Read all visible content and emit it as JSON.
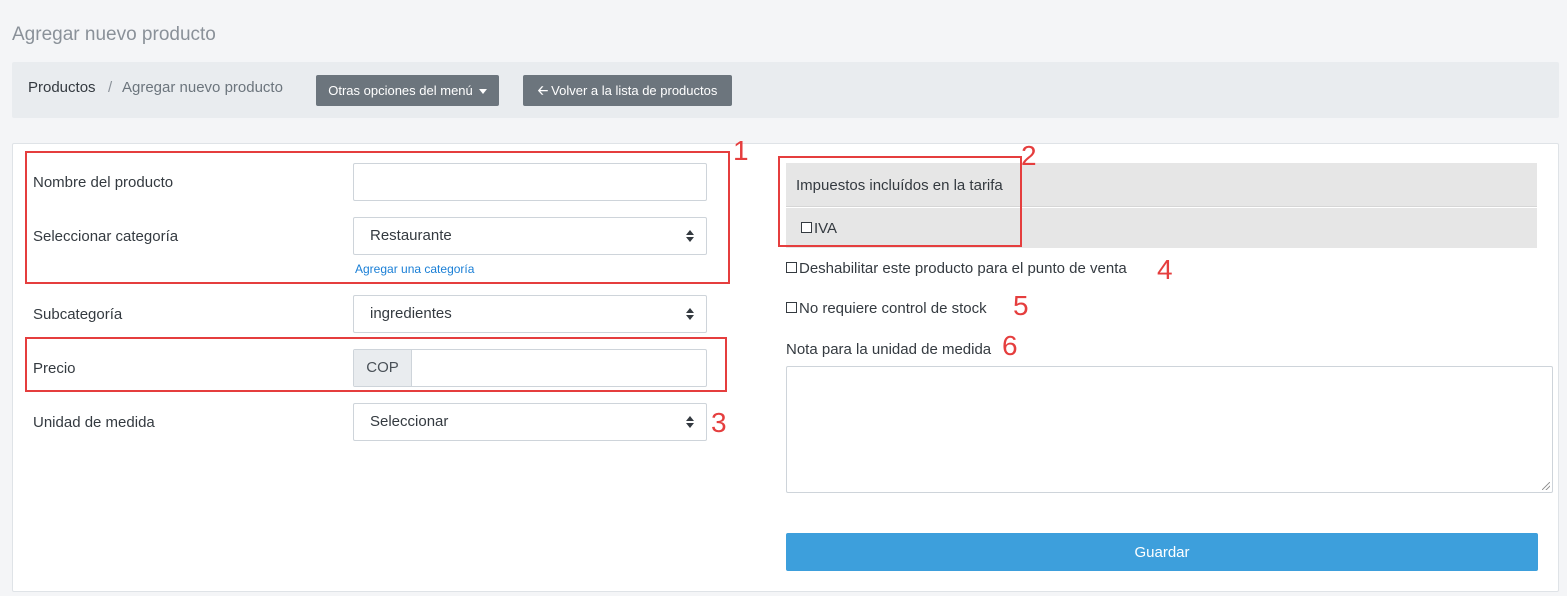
{
  "page": {
    "title": "Agregar nuevo producto"
  },
  "breadcrumb": {
    "root": "Productos",
    "separator": "/",
    "current": "Agregar nuevo producto"
  },
  "toolbar": {
    "menu_label": "Otras opciones del menú",
    "back_label": "Volver a la lista de productos",
    "back_icon": "arrow-left-icon"
  },
  "form": {
    "product_name": {
      "label": "Nombre del producto",
      "value": ""
    },
    "category": {
      "label": "Seleccionar categoría",
      "value": "Restaurante",
      "add_link": "Agregar una categoría"
    },
    "subcategory": {
      "label": "Subcategoría",
      "value": "ingredientes"
    },
    "price": {
      "label": "Precio",
      "currency": "COP",
      "value": ""
    },
    "unit": {
      "label": "Unidad de medida",
      "value": "Seleccionar"
    },
    "taxes": {
      "header": "Impuestos incluídos en la tarifa",
      "items": [
        {
          "label": "IVA",
          "checked": false
        }
      ]
    },
    "disable_pos": {
      "label": "Deshabilitar este producto para el punto de venta",
      "checked": false
    },
    "no_stock": {
      "label": "No requiere control de stock",
      "checked": false
    },
    "unit_note": {
      "label": "Nota para la unidad de medida",
      "value": ""
    },
    "save_label": "Guardar"
  },
  "annotations": {
    "n1": "1",
    "n2": "2",
    "n3": "3",
    "n4": "4",
    "n5": "5",
    "n6": "6"
  },
  "colors": {
    "annotation": "#e53e3e",
    "primary": "#3d9fdc",
    "secondary": "#6c757d"
  }
}
